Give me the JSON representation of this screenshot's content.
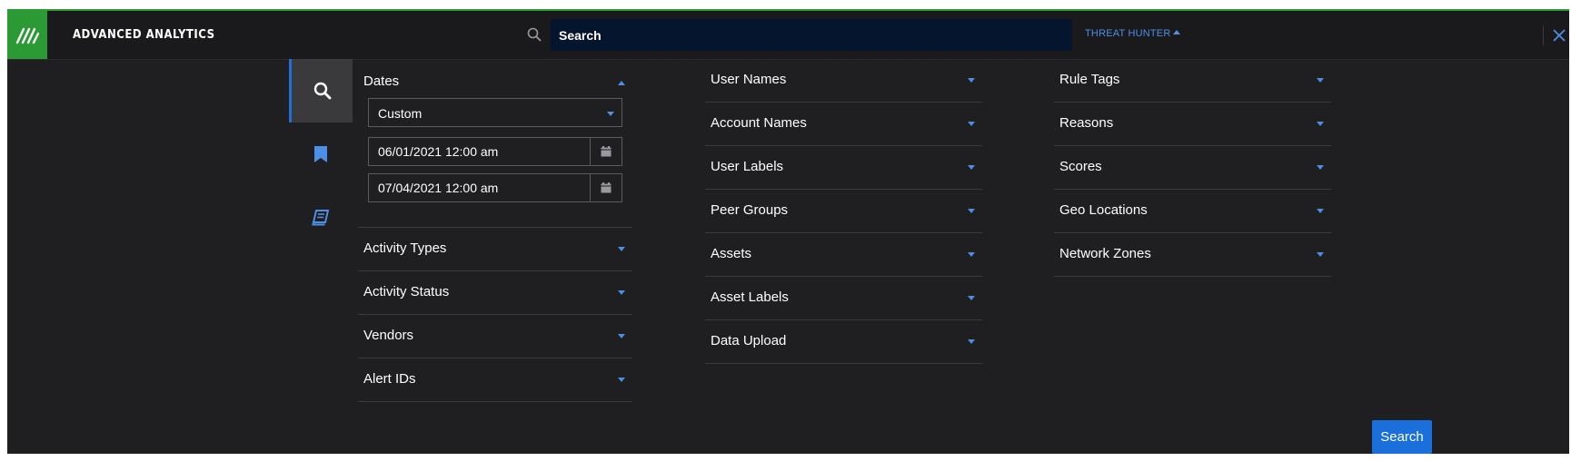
{
  "header": {
    "app_title": "ADVANCED ANALYTICS",
    "search_placeholder": "Search",
    "threat_hunter_label": "THREAT HUNTER",
    "logo_icon": "exabeam-logo-icon",
    "close_icon": "close-icon"
  },
  "rail": {
    "items": [
      {
        "icon": "search-icon",
        "active": true
      },
      {
        "icon": "bookmark-icon",
        "active": false
      },
      {
        "icon": "book-icon",
        "active": false
      }
    ]
  },
  "filters": {
    "dates": {
      "label": "Dates",
      "range_option": "Custom",
      "start": "06/01/2021 12:00 am",
      "end": "07/04/2021 12:00 am"
    },
    "column1": [
      "Activity Types",
      "Activity Status",
      "Vendors",
      "Alert IDs"
    ],
    "column2": [
      "User Names",
      "Account Names",
      "User Labels",
      "Peer Groups",
      "Assets",
      "Asset Labels",
      "Data Upload"
    ],
    "column3": [
      "Rule Tags",
      "Reasons",
      "Scores",
      "Geo Locations",
      "Network Zones"
    ]
  },
  "actions": {
    "search_label": "Search"
  },
  "colors": {
    "accent": "#1a6fdb",
    "brand_green": "#2b9a35",
    "background": "#1f1f21",
    "search_bg": "#06152e"
  }
}
